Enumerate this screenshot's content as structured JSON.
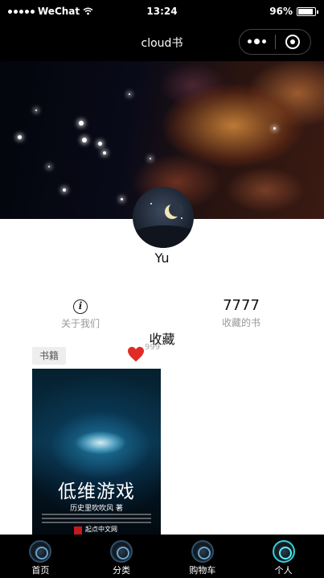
{
  "status_bar": {
    "carrier": "WeChat",
    "time": "13:24",
    "battery": "96%"
  },
  "nav_bar": {
    "title": "cloud书"
  },
  "profile": {
    "username": "Yu"
  },
  "stats": {
    "about_label": "关于我们",
    "favorites_count": "7777",
    "favorites_label": "收藏的书"
  },
  "section": {
    "title": "收藏"
  },
  "book_card": {
    "tag": "书籍",
    "likes": "999",
    "cover_title": "低维游戏",
    "cover_author": "历史里吹吹风 著",
    "cover_publisher": "起点中文网"
  },
  "tab_bar": {
    "tabs": [
      {
        "label": "首页"
      },
      {
        "label": "分类"
      },
      {
        "label": "购物车"
      },
      {
        "label": "个人"
      }
    ],
    "active_index": 3
  },
  "colors": {
    "heart": "#e02b27",
    "active_tab": "#2fd0d8"
  }
}
